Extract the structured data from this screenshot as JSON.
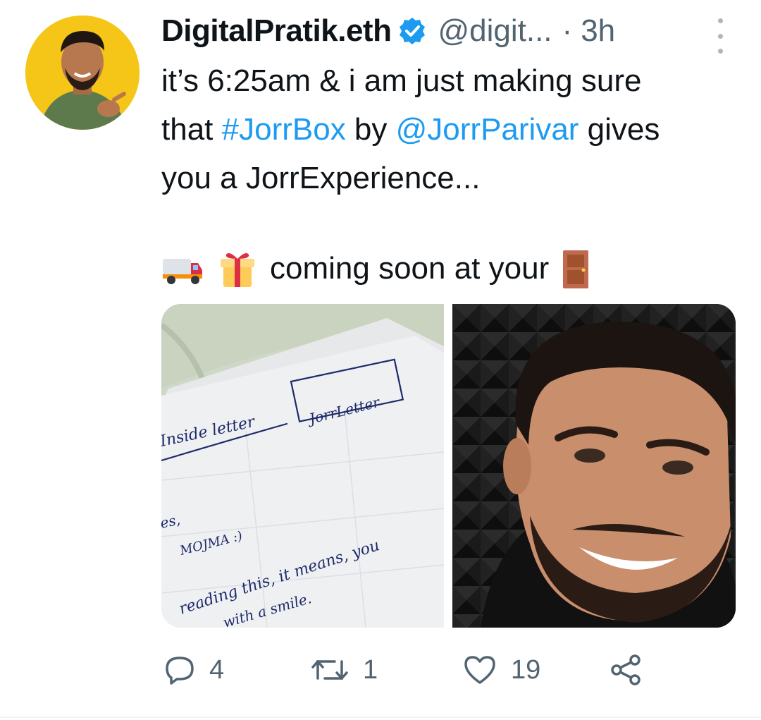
{
  "tweet": {
    "author_name": "DigitalPratik.eth",
    "handle": "@digit...",
    "separator": "·",
    "time": "3h",
    "text": {
      "line1": "it’s 6:25am & i am just making sure",
      "line2_prefix": "that ",
      "hashtag": "#JorrBox",
      "line2_mid": " by ",
      "mention": "@JorrParivar",
      "line2_suffix": " gives",
      "line3": "you a JorrExperience...",
      "line4_text": "coming soon at your"
    },
    "media": {
      "left_image": "handwritten-note-photo",
      "right_image": "smiling-man-selfie",
      "note_lines": [
        "Inside letter",
        "JorrLetter",
        "es,",
        "MOJMA :)",
        "reading this, it means, you",
        "with a smile."
      ]
    },
    "actions": {
      "reply_count": "4",
      "retweet_count": "1",
      "like_count": "19"
    },
    "colors": {
      "link": "#1d9bf0",
      "verified": "#1d9bf0",
      "muted": "#536471",
      "avatar_bg": "#f5c518"
    }
  }
}
